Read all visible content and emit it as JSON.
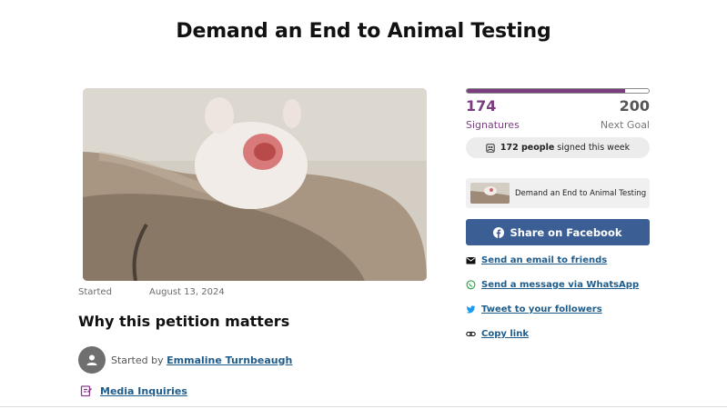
{
  "page": {
    "title": "Demand an End to Animal Testing"
  },
  "petition": {
    "started_label": "Started",
    "started_date": "August 13, 2024",
    "section_title": "Why this petition matters",
    "started_by_prefix": "Started by",
    "starter_name": "Emmaline Turnbeaugh",
    "media_link": "Media Inquiries"
  },
  "sidebar": {
    "progress_fraction": 0.87,
    "signatures_count": "174",
    "signatures_label": "Signatures",
    "goal_count": "200",
    "goal_label": "Next Goal",
    "week_count": "172 people",
    "week_text": "signed this week",
    "card_text": "Demand an End to Animal Testing",
    "facebook_label": "Share on Facebook",
    "share_links": {
      "email": "Send an email to friends",
      "whatsapp": "Send a message via WhatsApp",
      "twitter": "Tweet to your followers",
      "copy": "Copy link"
    }
  },
  "colors": {
    "accent": "#7a3e7e",
    "link": "#1f5c8a",
    "facebook": "#3b5e95"
  },
  "icons": [
    "person-icon",
    "media-inquiries-icon",
    "group-icon",
    "facebook-icon",
    "email-icon",
    "whatsapp-icon",
    "twitter-icon",
    "link-icon"
  ]
}
